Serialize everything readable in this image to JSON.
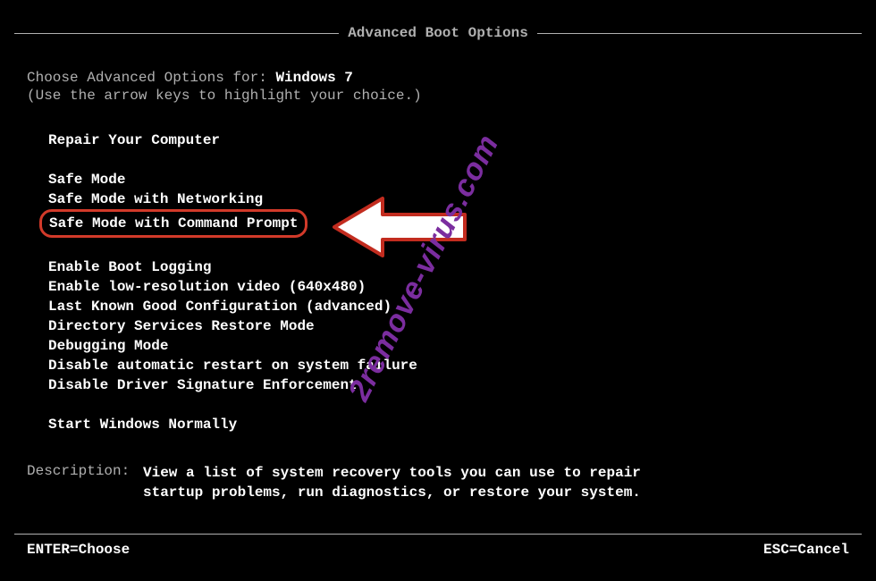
{
  "title": "Advanced Boot Options",
  "prompt_prefix": "Choose Advanced Options for: ",
  "os_name": "Windows 7",
  "hint": "(Use the arrow keys to highlight your choice.)",
  "groups": {
    "g1": {
      "i0": "Repair Your Computer"
    },
    "g2": {
      "i0": "Safe Mode",
      "i1": "Safe Mode with Networking",
      "i2": "Safe Mode with Command Prompt"
    },
    "g3": {
      "i0": "Enable Boot Logging",
      "i1": "Enable low-resolution video (640x480)",
      "i2": "Last Known Good Configuration (advanced)",
      "i3": "Directory Services Restore Mode",
      "i4": "Debugging Mode",
      "i5": "Disable automatic restart on system failure",
      "i6": "Disable Driver Signature Enforcement"
    },
    "g4": {
      "i0": "Start Windows Normally"
    }
  },
  "description_label": "Description:",
  "description_text": "View a list of system recovery tools you can use to repair startup problems, run diagnostics, or restore your system.",
  "footer": {
    "enter": "ENTER=Choose",
    "esc": "ESC=Cancel"
  },
  "watermark": "2remove-virus.com"
}
